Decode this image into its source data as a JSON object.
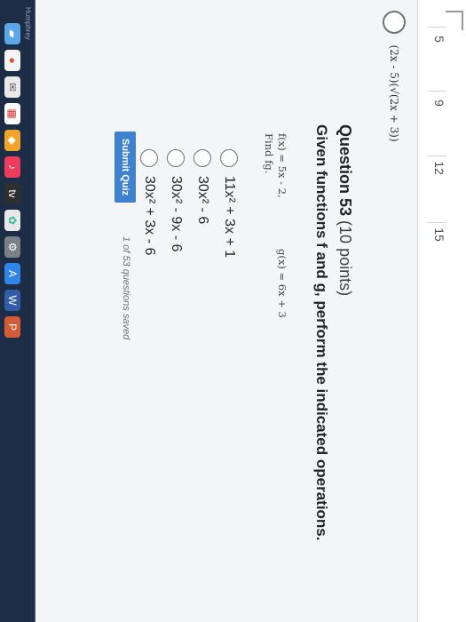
{
  "side_numbers": [
    "5",
    "9",
    "12",
    "15"
  ],
  "previous_answer": {
    "text": "(2x - 5)(√(2x + 3))"
  },
  "question": {
    "title": "Question 53",
    "points": "(10 points)",
    "instruction": "Given functions f and g, perform the indicated operations.",
    "f": "f(x) = 5x - 2,",
    "g": "g(x) = 6x + 3",
    "find": "Find fg."
  },
  "options": [
    {
      "label": "11x² + 3x + 1",
      "selected": false
    },
    {
      "label": "30x² - 6",
      "selected": false
    },
    {
      "label": "30x² - 9x - 6",
      "selected": false
    },
    {
      "label": "30x² + 3x - 6",
      "selected": false
    }
  ],
  "actions": {
    "submit_label": "Submit Quiz",
    "saved_status": "1 of 53 questions saved"
  },
  "taskbar": {
    "brand_text": "Humphrey",
    "icons": [
      "folder-icon",
      "chrome-icon",
      "mail-icon",
      "calendar-icon",
      "app-icon",
      "music-icon",
      "apple-tv-icon",
      "photos-icon",
      "settings-icon",
      "app-store-icon",
      "word-icon",
      "powerpoint-icon"
    ]
  },
  "colors": {
    "submit": "#3f80cf",
    "background": "#f4f5f7"
  }
}
